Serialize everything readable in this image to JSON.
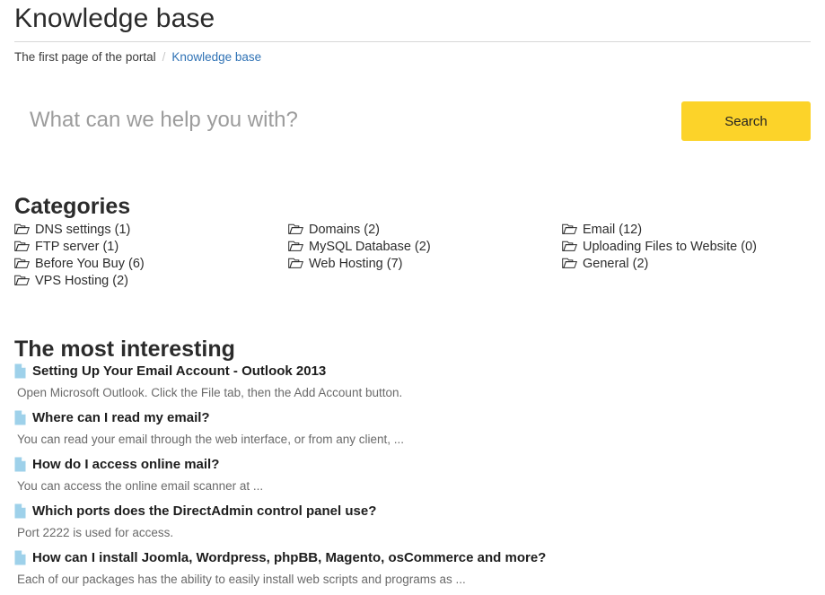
{
  "header": {
    "title": "Knowledge base"
  },
  "breadcrumb": {
    "root": "The first page of the portal",
    "separator": "/",
    "current": "Knowledge base"
  },
  "search": {
    "placeholder": "What can we help you with?",
    "value": "",
    "button_label": "Search"
  },
  "categories": {
    "heading": "Categories",
    "icon": "folder-open-icon",
    "columns": [
      [
        {
          "label": "DNS settings (1)"
        },
        {
          "label": "FTP server (1)"
        },
        {
          "label": "Before You Buy (6)"
        },
        {
          "label": "VPS Hosting (2)"
        }
      ],
      [
        {
          "label": "Domains (2)"
        },
        {
          "label": "MySQL Database (2)"
        },
        {
          "label": "Web Hosting (7)"
        }
      ],
      [
        {
          "label": "Email (12)"
        },
        {
          "label": "Uploading Files to Website (0)"
        },
        {
          "label": "General (2)"
        }
      ]
    ]
  },
  "interesting": {
    "heading": "The most interesting",
    "icon": "document-icon",
    "articles": [
      {
        "title": "Setting Up Your Email Account - Outlook 2013",
        "description": "Open Microsoft Outlook. Click the File tab, then the Add Account button."
      },
      {
        "title": "Where can I read my email?",
        "description": "You can read your email through the web interface, or from any client, ..."
      },
      {
        "title": "How do I access online mail?",
        "description": "You can access the online email scanner at ..."
      },
      {
        "title": "Which ports does the DirectAdmin control panel use?",
        "description": "Port 2222 is used for access."
      },
      {
        "title": "How can I install Joomla, Wordpress, phpBB, Magento, osCommerce and more?",
        "description": "Each of our packages has the ability to easily install web scripts and programs as ..."
      }
    ]
  },
  "colors": {
    "accent_button": "#fcd329",
    "link": "#2f72b5",
    "doc_icon": "#9ed1ea",
    "rule": "#d8d8d8",
    "heading": "#2b2b2b",
    "description": "#6a6a6a"
  }
}
